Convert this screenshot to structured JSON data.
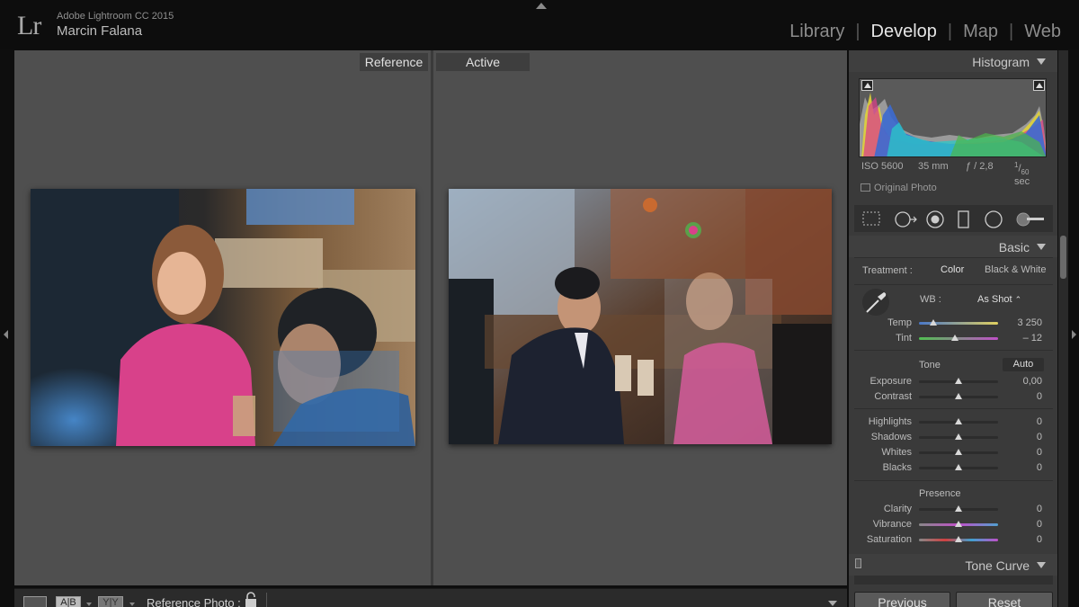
{
  "app": {
    "logo": "Lr",
    "name": "Adobe Lightroom CC 2015",
    "user": "Marcin Falana"
  },
  "modules": [
    {
      "label": "Library",
      "active": false
    },
    {
      "label": "Develop",
      "active": true
    },
    {
      "label": "Map",
      "active": false
    },
    {
      "label": "Web",
      "active": false
    }
  ],
  "compare": {
    "reference_label": "Reference",
    "active_label": "Active"
  },
  "toolbar": {
    "ab_label": "A|B",
    "yy_label": "Y|Y",
    "reference_photo_label": "Reference Photo :"
  },
  "histogram": {
    "title": "Histogram",
    "iso": "ISO 5600",
    "focal": "35 mm",
    "aperture": "ƒ / 2,8",
    "shutter_num": "1",
    "shutter_den": "60",
    "shutter_unit": "sec",
    "original_photo": "Original Photo"
  },
  "basic": {
    "title": "Basic",
    "treatment_label": "Treatment :",
    "treatment_color": "Color",
    "treatment_bw": "Black & White",
    "wb_label": "WB :",
    "wb_value": "As Shot",
    "wb_caret": "⌃",
    "tone_title": "Tone",
    "auto_label": "Auto",
    "presence_title": "Presence",
    "sliders": {
      "temp": {
        "label": "Temp",
        "value": "3 250"
      },
      "tint": {
        "label": "Tint",
        "value": "– 12"
      },
      "exposure": {
        "label": "Exposure",
        "value": "0,00"
      },
      "contrast": {
        "label": "Contrast",
        "value": "0"
      },
      "highlights": {
        "label": "Highlights",
        "value": "0"
      },
      "shadows": {
        "label": "Shadows",
        "value": "0"
      },
      "whites": {
        "label": "Whites",
        "value": "0"
      },
      "blacks": {
        "label": "Blacks",
        "value": "0"
      },
      "clarity": {
        "label": "Clarity",
        "value": "0"
      },
      "vibrance": {
        "label": "Vibrance",
        "value": "0"
      },
      "saturation": {
        "label": "Saturation",
        "value": "0"
      }
    }
  },
  "tone_curve": {
    "title": "Tone Curve"
  },
  "buttons": {
    "previous": "Previous",
    "reset": "Reset"
  },
  "colors": {
    "accent_pink": "#d8418a",
    "panel_bg": "#3a3a3a",
    "workspace_bg": "#4f4f4f"
  }
}
